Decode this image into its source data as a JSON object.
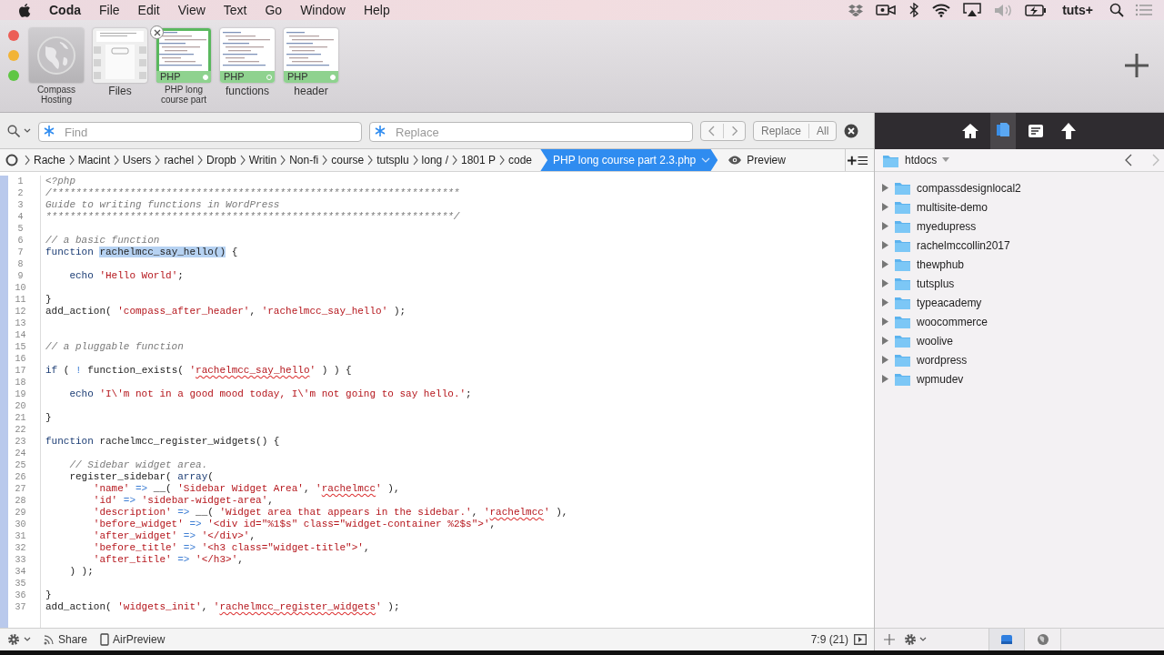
{
  "menu_bar": {
    "app": "Coda",
    "menus": [
      "File",
      "Edit",
      "View",
      "Text",
      "Go",
      "Window",
      "Help"
    ],
    "status_text": "tuts+"
  },
  "tabs": [
    {
      "kind": "site",
      "label": "Compass Hosting",
      "selected": false
    },
    {
      "kind": "files",
      "label": "Files",
      "selected": false
    },
    {
      "kind": "document",
      "label": "PHP long course part",
      "badge": "PHP",
      "saved": true,
      "selected": true
    },
    {
      "kind": "document",
      "label": "functions",
      "badge": "PHP",
      "saved": false,
      "selected": false
    },
    {
      "kind": "document",
      "label": "header",
      "badge": "PHP",
      "saved": true,
      "selected": false
    }
  ],
  "find_bar": {
    "find_placeholder": "Find",
    "replace_placeholder": "Replace",
    "buttons": [
      "Replace",
      "All"
    ]
  },
  "breadcrumb": [
    {
      "label": "Rache",
      "selected": false
    },
    {
      "label": "Macint",
      "selected": false
    },
    {
      "label": "Users",
      "selected": false
    },
    {
      "label": "rachel",
      "selected": false
    },
    {
      "label": "Dropb",
      "selected": false
    },
    {
      "label": "Writin",
      "selected": false
    },
    {
      "label": "Non-fi",
      "selected": false
    },
    {
      "label": "course",
      "selected": false
    },
    {
      "label": "tutsplu",
      "selected": false
    },
    {
      "label": "long /",
      "selected": false
    },
    {
      "label": "1801 P",
      "selected": false
    },
    {
      "label": "code",
      "selected": false
    },
    {
      "label": "PHP long course part 2.3.php",
      "selected": true
    }
  ],
  "preview_button": "Preview",
  "code_lines": [
    {
      "number": "1",
      "tokens": [
        {
          "kind": "comment",
          "text": "<?php"
        }
      ]
    },
    {
      "number": "2",
      "tokens": [
        {
          "kind": "comment",
          "text": "/********************************************************************"
        }
      ]
    },
    {
      "number": "3",
      "tokens": [
        {
          "kind": "comment",
          "text": "Guide to writing functions in WordPress"
        }
      ]
    },
    {
      "number": "4",
      "tokens": [
        {
          "kind": "comment",
          "text": "********************************************************************/"
        }
      ]
    },
    {
      "number": "5"
    },
    {
      "number": "6",
      "tokens": [
        {
          "kind": "comment",
          "text": "// a basic function"
        }
      ]
    },
    {
      "number": "7",
      "tokens": [
        {
          "kind": "keyword",
          "text": "function "
        },
        {
          "kind": "selection",
          "text": "rachelmcc_say_hello()"
        },
        {
          "kind": "plain",
          "text": " {"
        }
      ]
    },
    {
      "number": "8"
    },
    {
      "number": "9",
      "tokens": [
        {
          "kind": "keyword",
          "text": "    echo"
        },
        {
          "kind": "string",
          "text": " 'Hello World'"
        },
        {
          "kind": "plain",
          "text": ";"
        }
      ]
    },
    {
      "number": "10"
    },
    {
      "number": "11",
      "tokens": [
        {
          "kind": "plain",
          "text": "}"
        }
      ]
    },
    {
      "number": "12",
      "tokens": [
        {
          "kind": "plain",
          "text": "add_action( "
        },
        {
          "kind": "string",
          "text": "'compass_after_header'"
        },
        {
          "kind": "plain",
          "text": ", "
        },
        {
          "kind": "string",
          "text": "'rachelmcc_say_hello'"
        },
        {
          "kind": "plain",
          "text": " );"
        }
      ]
    },
    {
      "number": "13"
    },
    {
      "number": "14"
    },
    {
      "number": "15",
      "tokens": [
        {
          "kind": "comment",
          "text": "// a pluggable function"
        }
      ]
    },
    {
      "number": "16"
    },
    {
      "number": "17",
      "tokens": [
        {
          "kind": "keyword",
          "text": "if"
        },
        {
          "kind": "plain",
          "text": " ( "
        },
        {
          "kind": "operator",
          "text": "!"
        },
        {
          "kind": "plain",
          "text": " function_exists( "
        },
        {
          "kind": "string",
          "text": "'"
        },
        {
          "kind": "misspelled",
          "text": "rachelmcc_say_hello"
        },
        {
          "kind": "string",
          "text": "'"
        },
        {
          "kind": "plain",
          "text": " ) ) {"
        }
      ]
    },
    {
      "number": "18"
    },
    {
      "number": "19",
      "tokens": [
        {
          "kind": "keyword",
          "text": "    echo"
        },
        {
          "kind": "string",
          "text": " 'I\\'m not in a good mood today, I\\'m not going to say hello.'"
        },
        {
          "kind": "plain",
          "text": ";"
        }
      ]
    },
    {
      "number": "20"
    },
    {
      "number": "21",
      "tokens": [
        {
          "kind": "plain",
          "text": "}"
        }
      ]
    },
    {
      "number": "22"
    },
    {
      "number": "23",
      "tokens": [
        {
          "kind": "keyword",
          "text": "function"
        },
        {
          "kind": "plain",
          "text": " rachelmcc_register_widgets() {"
        }
      ]
    },
    {
      "number": "24"
    },
    {
      "number": "25",
      "tokens": [
        {
          "kind": "comment",
          "text": "    // Sidebar widget area."
        }
      ]
    },
    {
      "number": "26",
      "tokens": [
        {
          "kind": "plain",
          "text": "    register_sidebar( "
        },
        {
          "kind": "keyword",
          "text": "array"
        },
        {
          "kind": "plain",
          "text": "("
        }
      ]
    },
    {
      "number": "27",
      "tokens": [
        {
          "kind": "string",
          "text": "        'name'"
        },
        {
          "kind": "operator",
          "text": " =>"
        },
        {
          "kind": "plain",
          "text": " __( "
        },
        {
          "kind": "string",
          "text": "'Sidebar Widget Area'"
        },
        {
          "kind": "plain",
          "text": ", "
        },
        {
          "kind": "string",
          "text": "'"
        },
        {
          "kind": "misspelled",
          "text": "rachelmcc"
        },
        {
          "kind": "string",
          "text": "'"
        },
        {
          "kind": "plain",
          "text": " ),"
        }
      ]
    },
    {
      "number": "28",
      "tokens": [
        {
          "kind": "string",
          "text": "        'id'"
        },
        {
          "kind": "operator",
          "text": " =>"
        },
        {
          "kind": "string",
          "text": " 'sidebar-widget-area'"
        },
        {
          "kind": "plain",
          "text": ","
        }
      ]
    },
    {
      "number": "29",
      "tokens": [
        {
          "kind": "string",
          "text": "        'description'"
        },
        {
          "kind": "operator",
          "text": " =>"
        },
        {
          "kind": "plain",
          "text": " __( "
        },
        {
          "kind": "string",
          "text": "'Widget area that appears in the sidebar.'"
        },
        {
          "kind": "plain",
          "text": ", "
        },
        {
          "kind": "string",
          "text": "'"
        },
        {
          "kind": "misspelled",
          "text": "rachelmcc"
        },
        {
          "kind": "string",
          "text": "'"
        },
        {
          "kind": "plain",
          "text": " ),"
        }
      ]
    },
    {
      "number": "30",
      "tokens": [
        {
          "kind": "string",
          "text": "        'before_widget'"
        },
        {
          "kind": "operator",
          "text": " =>"
        },
        {
          "kind": "string",
          "text": " '<div id=\"%1$s\" class=\"widget-container %2$s\">'"
        },
        {
          "kind": "plain",
          "text": ","
        }
      ]
    },
    {
      "number": "31",
      "tokens": [
        {
          "kind": "string",
          "text": "        'after_widget'"
        },
        {
          "kind": "operator",
          "text": " =>"
        },
        {
          "kind": "string",
          "text": " '</div>'"
        },
        {
          "kind": "plain",
          "text": ","
        }
      ]
    },
    {
      "number": "32",
      "tokens": [
        {
          "kind": "string",
          "text": "        'before_title'"
        },
        {
          "kind": "operator",
          "text": " =>"
        },
        {
          "kind": "string",
          "text": " '<h3 class=\"widget-title\">'"
        },
        {
          "kind": "plain",
          "text": ","
        }
      ]
    },
    {
      "number": "33",
      "tokens": [
        {
          "kind": "string",
          "text": "        'after_title'"
        },
        {
          "kind": "operator",
          "text": " =>"
        },
        {
          "kind": "string",
          "text": " '</h3>'"
        },
        {
          "kind": "plain",
          "text": ","
        }
      ]
    },
    {
      "number": "34",
      "tokens": [
        {
          "kind": "plain",
          "text": "    ) );"
        }
      ]
    },
    {
      "number": "35"
    },
    {
      "number": "36",
      "tokens": [
        {
          "kind": "plain",
          "text": "}"
        }
      ]
    },
    {
      "number": "37",
      "tokens": [
        {
          "kind": "plain",
          "text": "add_action( "
        },
        {
          "kind": "string",
          "text": "'widgets_init'"
        },
        {
          "kind": "plain",
          "text": ", "
        },
        {
          "kind": "string",
          "text": "'"
        },
        {
          "kind": "misspelled",
          "text": "rachelmcc_register_widgets"
        },
        {
          "kind": "string",
          "text": "'"
        },
        {
          "kind": "plain",
          "text": " );"
        }
      ]
    }
  ],
  "status_bar": {
    "share": "Share",
    "airpreview": "AirPreview",
    "cursor": "7:9 (21)"
  },
  "panel_tabs": [
    {
      "kind": "home",
      "selected": false
    },
    {
      "kind": "files",
      "selected": true
    },
    {
      "kind": "text",
      "selected": false
    },
    {
      "kind": "publish",
      "selected": false
    }
  ],
  "file_browser": {
    "folder": "htdocs",
    "items": [
      {
        "name": "compassdesignlocal2",
        "expanded": false
      },
      {
        "name": "multisite-demo",
        "expanded": false
      },
      {
        "name": "myedupress",
        "expanded": false
      },
      {
        "name": "rachelmccollin2017",
        "expanded": false
      },
      {
        "name": "thewphub",
        "expanded": false
      },
      {
        "name": "tutsplus",
        "expanded": false
      },
      {
        "name": "typeacademy",
        "expanded": false
      },
      {
        "name": "woocommerce",
        "expanded": false
      },
      {
        "name": "woolive",
        "expanded": false
      },
      {
        "name": "wordpress",
        "expanded": false
      },
      {
        "name": "wpmudev",
        "expanded": false
      }
    ]
  },
  "sidebar_modes": [
    {
      "kind": "local",
      "selected": true
    },
    {
      "kind": "remote",
      "selected": false
    }
  ]
}
